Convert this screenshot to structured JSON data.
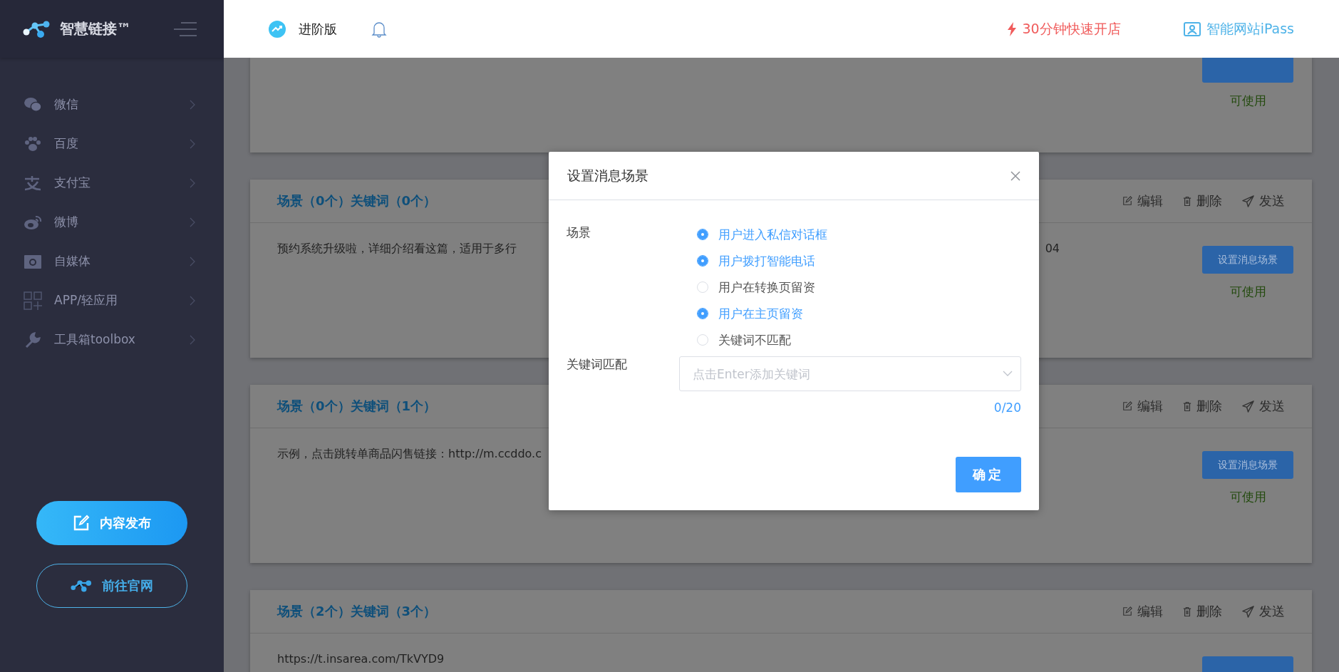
{
  "sidebar": {
    "brand": "智慧链接™",
    "items": [
      {
        "label": "微信"
      },
      {
        "label": "百度"
      },
      {
        "label": "支付宝"
      },
      {
        "label": "微博"
      },
      {
        "label": "自媒体"
      },
      {
        "label": "APP/轻应用"
      },
      {
        "label": "工具箱toolbox"
      }
    ],
    "buttons": [
      {
        "label": "内容发布",
        "kind": "primary"
      },
      {
        "label": "前往官网",
        "kind": "outline"
      }
    ]
  },
  "header": {
    "plan": "进阶版",
    "promo": "30分钟快速开店",
    "site_link": "智能网站iPass"
  },
  "cards": [
    {
      "status": "可使用"
    },
    {
      "title": "场景（0个）关键词（0个）",
      "actions": [
        "编辑",
        "删除",
        "发送"
      ],
      "text": "预约系统升级啦，详细介绍看这篇，适用于多行",
      "text_tail": "04",
      "button": "设置消息场景",
      "status": "可使用"
    },
    {
      "title": "场景（0个）关键词（1个）",
      "actions": [
        "编辑",
        "删除",
        "发送"
      ],
      "text": "示例，点击跳转单商品闪售链接：http://m.ccddo.c",
      "button": "设置消息场景",
      "status": "可使用"
    },
    {
      "title": "场景（2个）关键词（3个）",
      "actions": [
        "编辑",
        "删除",
        "发送"
      ],
      "text": "https://t.insarea.com/TkVYD9"
    }
  ],
  "dialog": {
    "title": "设置消息场景",
    "scene_label": "场景",
    "options": [
      {
        "label": "用户进入私信对话框",
        "checked": true
      },
      {
        "label": "用户拨打智能电话",
        "checked": true
      },
      {
        "label": "用户在转换页留资",
        "checked": false
      },
      {
        "label": "用户在主页留资",
        "checked": true
      },
      {
        "label": "关键词不匹配",
        "checked": false
      }
    ],
    "keyword_label": "关键词匹配",
    "keyword_placeholder": "点击Enter添加关键词",
    "counter": "0/20",
    "confirm": "确定"
  }
}
